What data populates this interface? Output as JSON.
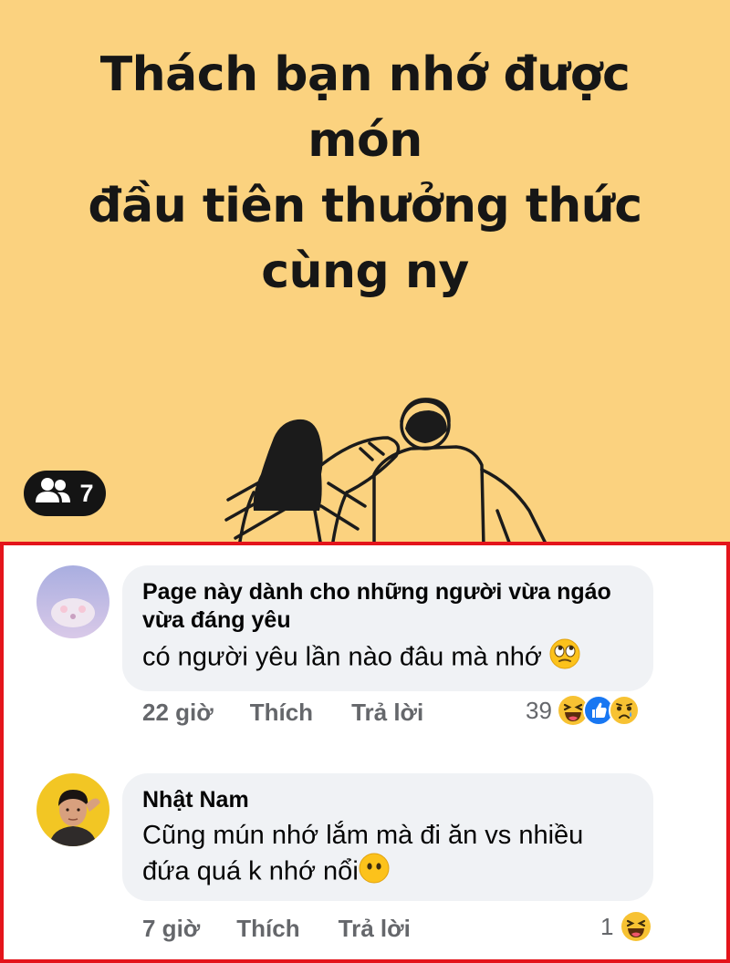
{
  "poster": {
    "title_line1": "Thách bạn nhớ được món",
    "title_line2": "đầu tiên thưởng thức",
    "title_line3": "cùng ny",
    "participants_count": "7"
  },
  "comments": [
    {
      "author": "Page này dành cho những người vừa ngáo vừa đáng yêu",
      "text": "có người yêu lần nào đâu mà nhớ",
      "time": "22 giờ",
      "like_label": "Thích",
      "reply_label": "Trả lời",
      "reaction_count": "39",
      "reactions": [
        "haha-reaction-icon",
        "like-reaction-icon",
        "sad-reaction-icon"
      ],
      "inline_emoji": "eye-roll-emoji"
    },
    {
      "author": "Nhật Nam",
      "text_line1": "Cũng mún nhớ lắm mà đi ăn vs nhiều",
      "text_line2": "đứa quá k nhớ nổi",
      "time": "7 giờ",
      "like_label": "Thích",
      "reply_label": "Trả lời",
      "reaction_count": "1",
      "reactions": [
        "haha-reaction-icon"
      ],
      "inline_emoji": "no-mouth-emoji"
    }
  ],
  "colors": {
    "poster_bg": "#fbd27f",
    "highlight_border": "#e4141b",
    "bubble_bg": "#f0f2f5",
    "meta_text": "#65676b"
  }
}
